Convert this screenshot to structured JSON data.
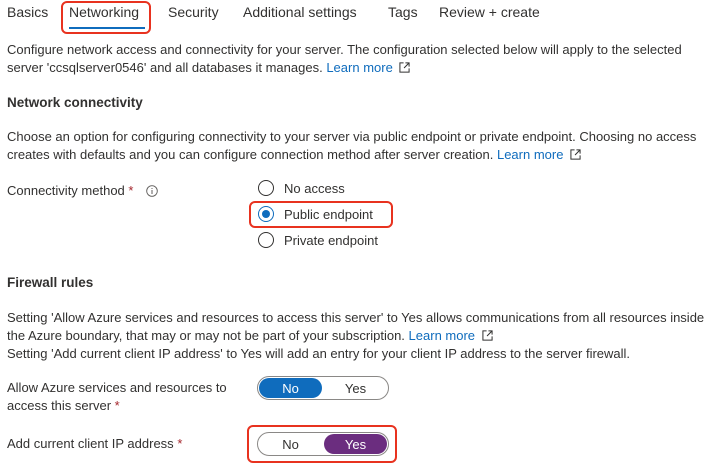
{
  "tabs": [
    {
      "label": "Basics"
    },
    {
      "label": "Networking"
    },
    {
      "label": "Security"
    },
    {
      "label": "Additional settings"
    },
    {
      "label": "Tags"
    },
    {
      "label": "Review + create"
    }
  ],
  "active_tab": "Networking",
  "intro": {
    "line1": "Configure network access and connectivity for your server. The configuration selected below will apply to the selected",
    "line2": "server 'ccsqlserver0546' and all databases it manages.",
    "link": "Learn more"
  },
  "network_connectivity": {
    "title": "Network connectivity",
    "desc_line1": "Choose an option for configuring connectivity to your server via public endpoint or private endpoint. Choosing no access",
    "desc_line2": "creates with defaults and you can configure connection method after server creation.",
    "link": "Learn more",
    "method_label": "Connectivity method",
    "required_mark": "*",
    "options": [
      {
        "label": "No access",
        "checked": false
      },
      {
        "label": "Public endpoint",
        "checked": true
      },
      {
        "label": "Private endpoint",
        "checked": false
      }
    ]
  },
  "firewall": {
    "title": "Firewall rules",
    "desc_line1": "Setting 'Allow Azure services and resources to access this server' to Yes allows communications from all resources inside",
    "desc_line2": "the Azure boundary, that may or may not be part of your subscription.",
    "link": "Learn more",
    "desc_line3": "Setting 'Add current client IP address' to Yes will add an entry for your client IP address to the server firewall.",
    "allow_azure": {
      "label_line1": "Allow Azure services and resources to",
      "label_line2": "access this server",
      "required_mark": "*",
      "no": "No",
      "yes": "Yes",
      "selected": "No"
    },
    "client_ip": {
      "label": "Add current client IP address",
      "required_mark": "*",
      "no": "No",
      "yes": "Yes",
      "selected": "Yes"
    }
  },
  "colors": {
    "accent": "#0f6cbd",
    "highlight": "#e8321f",
    "toggle_yes": "#6b2d7f",
    "required": "#a4262c"
  }
}
